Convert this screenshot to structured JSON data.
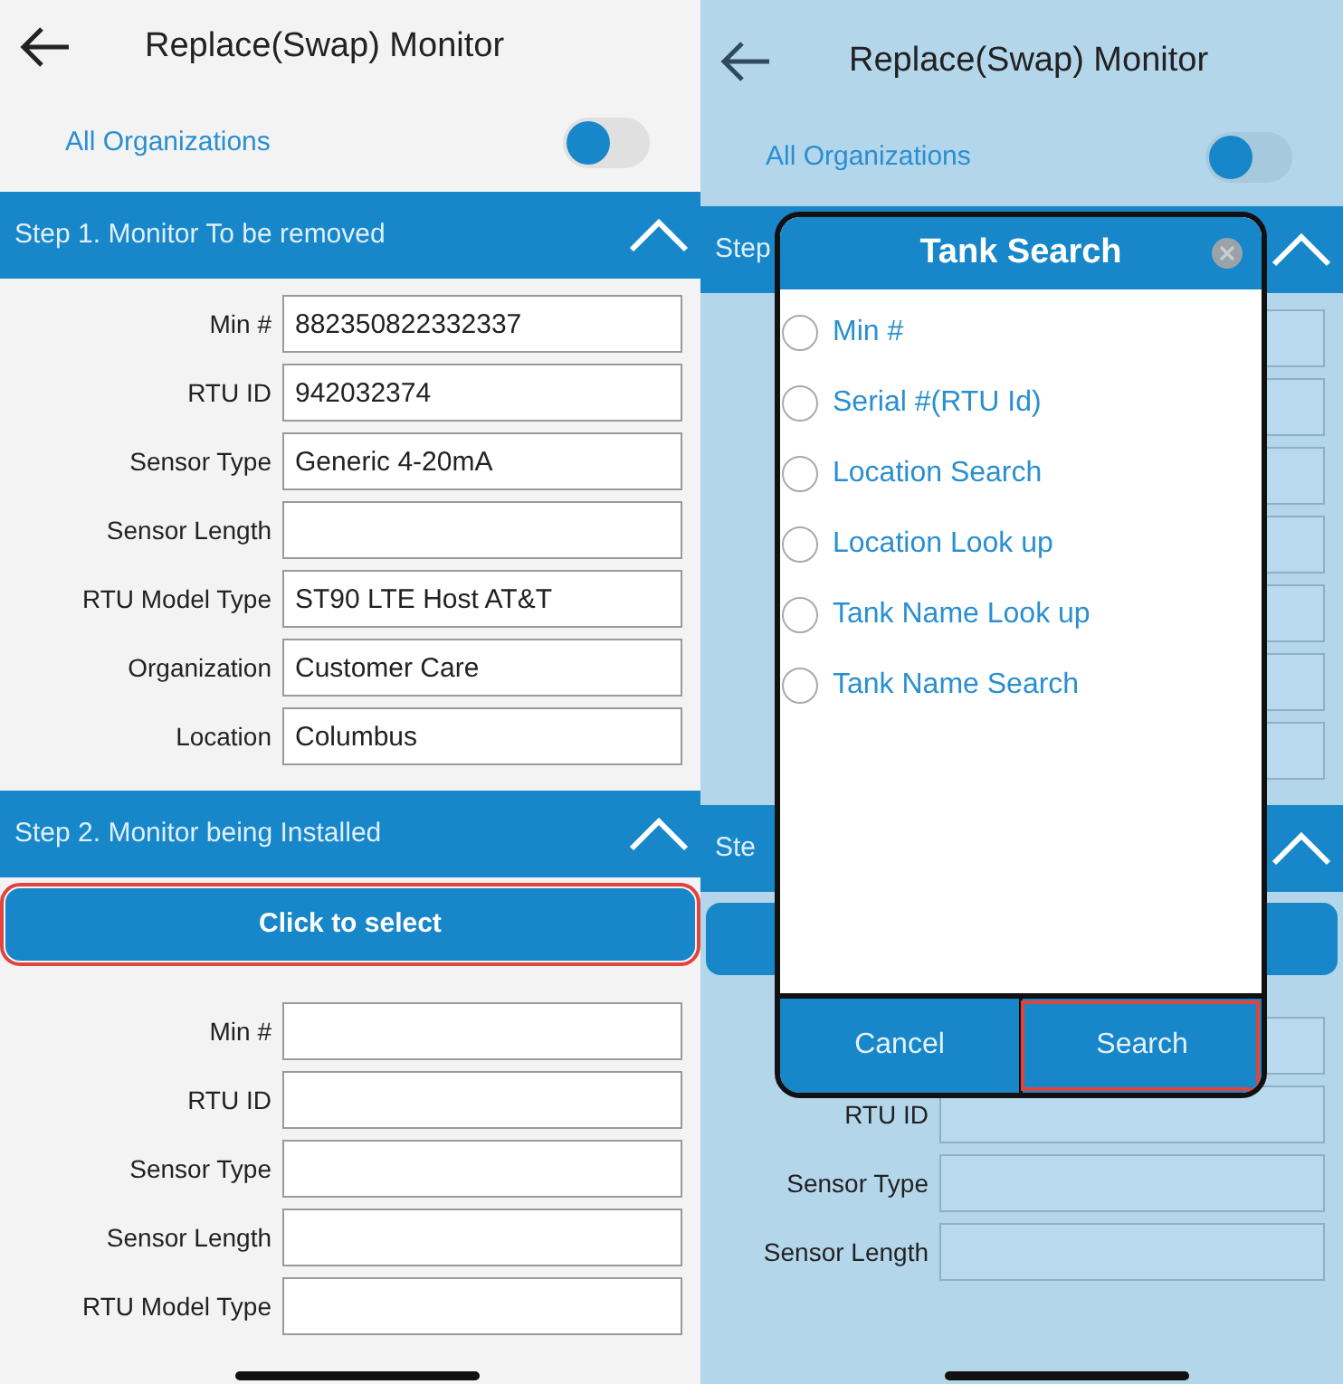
{
  "screens": [
    {
      "title": "Replace(Swap) Monitor",
      "all_organizations": {
        "label": "All Organizations",
        "on": false
      },
      "sections": [
        {
          "title": "Step 1. Monitor To be removed",
          "expanded": true,
          "fields": [
            {
              "kind": "text",
              "label": "Min #",
              "value": "882350822332337"
            },
            {
              "kind": "text",
              "label": "RTU ID",
              "value": "942032374"
            },
            {
              "kind": "text",
              "label": "Sensor Type",
              "value": "Generic 4-20mA"
            },
            {
              "kind": "text",
              "label": "Sensor Length"
            },
            {
              "kind": "text",
              "label": "RTU Model Type",
              "value": "ST90 LTE Host AT&T"
            },
            {
              "kind": "text",
              "label": "Organization",
              "value": "Customer Care"
            },
            {
              "kind": "text",
              "label": "Location",
              "value": "Columbus"
            }
          ]
        },
        {
          "title": "Step 2. Monitor being Installed",
          "expanded": true,
          "select_button": {
            "label": "Click to select",
            "highlighted": true
          },
          "fields": [
            {
              "kind": "text",
              "label": "Min #"
            },
            {
              "kind": "text",
              "label": "RTU ID"
            },
            {
              "kind": "text",
              "label": "Sensor Type"
            },
            {
              "kind": "text",
              "label": "Sensor Length"
            },
            {
              "kind": "text",
              "label": "RTU Model Type"
            }
          ]
        }
      ]
    },
    {
      "title": "Replace(Swap) Monitor",
      "all_organizations": {
        "label": "All Organizations",
        "on": false
      },
      "sections": [
        {
          "title": "Step",
          "expanded": true,
          "fields": [
            {
              "kind": "text"
            },
            {
              "kind": "text"
            },
            {
              "kind": "text"
            },
            {
              "kind": "text"
            },
            {
              "kind": "text"
            },
            {
              "kind": "text"
            },
            {
              "kind": "text"
            }
          ]
        },
        {
          "title": "Ste",
          "expanded": true,
          "select_button": {
            "highlighted": false
          },
          "fields": [
            {
              "kind": "text"
            },
            {
              "kind": "text",
              "label": "RTU ID"
            },
            {
              "kind": "text",
              "label": "Sensor Type"
            },
            {
              "kind": "text",
              "label": "Sensor Length"
            }
          ]
        }
      ],
      "dialog": {
        "title": "Tank Search",
        "options": [
          {
            "label": "Min #",
            "selected": false
          },
          {
            "label": "Serial #(RTU Id)",
            "selected": false
          },
          {
            "label": "Location Search",
            "selected": false
          },
          {
            "label": "Location Look up",
            "selected": false
          },
          {
            "label": "Tank Name Look up",
            "selected": false
          },
          {
            "label": "Tank Name Search",
            "selected": false
          }
        ],
        "buttons": [
          {
            "label": "Cancel",
            "highlighted": false
          },
          {
            "label": "Search",
            "highlighted": true
          }
        ]
      }
    }
  ]
}
